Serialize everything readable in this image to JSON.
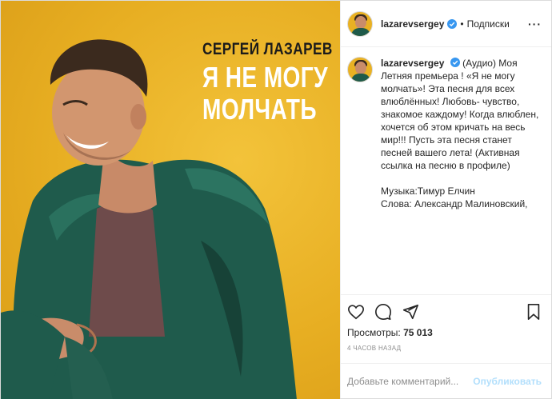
{
  "cover": {
    "artist": "СЕРГЕЙ ЛАЗАРЕВ",
    "song_line1": "Я НЕ МОГУ",
    "song_line2": "МОЛЧАТЬ"
  },
  "header": {
    "username": "lazarevsergey",
    "separator": "•",
    "follow_label": "Подписки",
    "more_label": "···"
  },
  "caption": {
    "username": "lazarevsergey",
    "text": "(Аудио) Моя Летняя премьера ! «Я не могу молчать»! Эта песня для всех влюблённых! Любовь- чувство, знакомое каждому! Когда влюблен, хочется об этом кричать на весь мир!!! Пусть эта песня станет песней вашего лета! (Активная ссылка на песню в профиле)",
    "music_credit": "Музыка:Тимур Елчин",
    "lyrics_credit": "Слова: Александр Малиновский,"
  },
  "stats": {
    "views_label": "Просмотры:",
    "views_count": "75 013",
    "timestamp": "4 часов назад"
  },
  "comment_box": {
    "placeholder": "Добавьте комментарий...",
    "publish_label": "Опубликовать"
  },
  "icons": {
    "like": "heart-icon",
    "comment": "comment-icon",
    "share": "share-icon",
    "save": "bookmark-icon",
    "verified": "verified-badge-icon",
    "more": "more-options-icon"
  },
  "colors": {
    "background_yellow": "#e9b123",
    "verified_blue": "#3897f0",
    "publish_disabled": "#b2dffc",
    "muted_text": "#8e8e8e"
  }
}
